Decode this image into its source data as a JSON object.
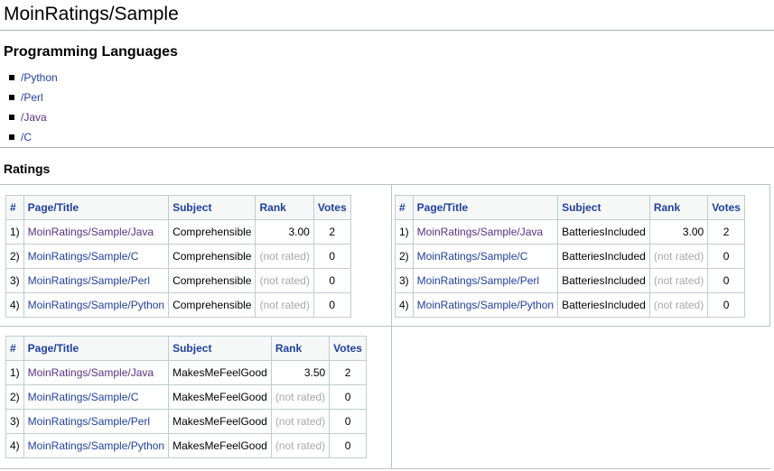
{
  "page": {
    "title": "MoinRatings/Sample"
  },
  "languages": {
    "heading": "Programming Languages",
    "items": [
      {
        "label": "/Python",
        "visited": false
      },
      {
        "label": "/Perl",
        "visited": false
      },
      {
        "label": "/Java",
        "visited": true
      },
      {
        "label": "/C",
        "visited": false
      }
    ]
  },
  "ratings": {
    "heading": "Ratings",
    "columns": [
      "#",
      "Page/Title",
      "Subject",
      "Rank",
      "Votes"
    ],
    "not_rated": "(not rated)",
    "tables": [
      {
        "rows": [
          {
            "idx": "1)",
            "page": "MoinRatings/Sample/Java",
            "visited": true,
            "subject": "Comprehensible",
            "rank": "3.00",
            "votes": "2"
          },
          {
            "idx": "2)",
            "page": "MoinRatings/Sample/C",
            "visited": false,
            "subject": "Comprehensible",
            "rank": null,
            "votes": "0"
          },
          {
            "idx": "3)",
            "page": "MoinRatings/Sample/Perl",
            "visited": false,
            "subject": "Comprehensible",
            "rank": null,
            "votes": "0"
          },
          {
            "idx": "4)",
            "page": "MoinRatings/Sample/Python",
            "visited": false,
            "subject": "Comprehensible",
            "rank": null,
            "votes": "0"
          }
        ]
      },
      {
        "rows": [
          {
            "idx": "1)",
            "page": "MoinRatings/Sample/Java",
            "visited": true,
            "subject": "BatteriesIncluded",
            "rank": "3.00",
            "votes": "2"
          },
          {
            "idx": "2)",
            "page": "MoinRatings/Sample/C",
            "visited": false,
            "subject": "BatteriesIncluded",
            "rank": null,
            "votes": "0"
          },
          {
            "idx": "3)",
            "page": "MoinRatings/Sample/Perl",
            "visited": false,
            "subject": "BatteriesIncluded",
            "rank": null,
            "votes": "0"
          },
          {
            "idx": "4)",
            "page": "MoinRatings/Sample/Python",
            "visited": false,
            "subject": "BatteriesIncluded",
            "rank": null,
            "votes": "0"
          }
        ]
      },
      {
        "rows": [
          {
            "idx": "1)",
            "page": "MoinRatings/Sample/Java",
            "visited": true,
            "subject": "MakesMeFeelGood",
            "rank": "3.50",
            "votes": "2"
          },
          {
            "idx": "2)",
            "page": "MoinRatings/Sample/C",
            "visited": false,
            "subject": "MakesMeFeelGood",
            "rank": null,
            "votes": "0"
          },
          {
            "idx": "3)",
            "page": "MoinRatings/Sample/Perl",
            "visited": false,
            "subject": "MakesMeFeelGood",
            "rank": null,
            "votes": "0"
          },
          {
            "idx": "4)",
            "page": "MoinRatings/Sample/Python",
            "visited": false,
            "subject": "MakesMeFeelGood",
            "rank": null,
            "votes": "0"
          }
        ]
      }
    ]
  },
  "colors": {
    "link": "#1f3f9f",
    "visited": "#5d2f88",
    "not_rated": "#a8a8a8"
  }
}
